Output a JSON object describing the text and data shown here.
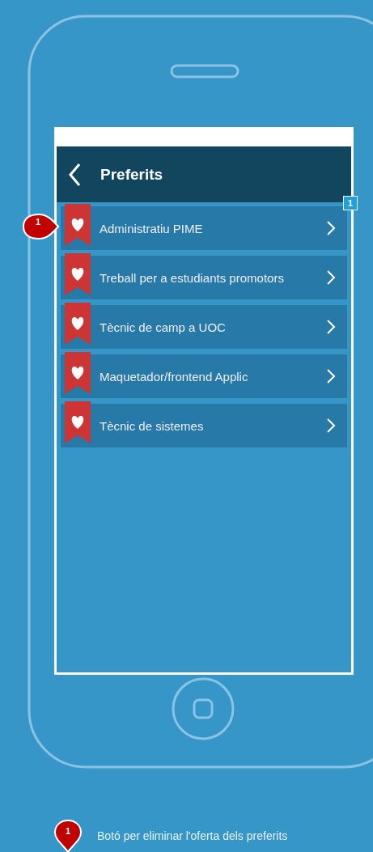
{
  "header": {
    "title": "Preferits"
  },
  "badge": "1",
  "items": [
    {
      "label": "Administratiu PIME",
      "callout": "1"
    },
    {
      "label": "Treball per a estudiants promotors"
    },
    {
      "label": "Tècnic de camp a UOC"
    },
    {
      "label": "Maquetador/frontend Applic"
    },
    {
      "label": "Tècnic de sistemes"
    }
  ],
  "legend": [
    {
      "marker": "1",
      "text": "Botó per eliminar l'oferta dels preferits"
    }
  ]
}
